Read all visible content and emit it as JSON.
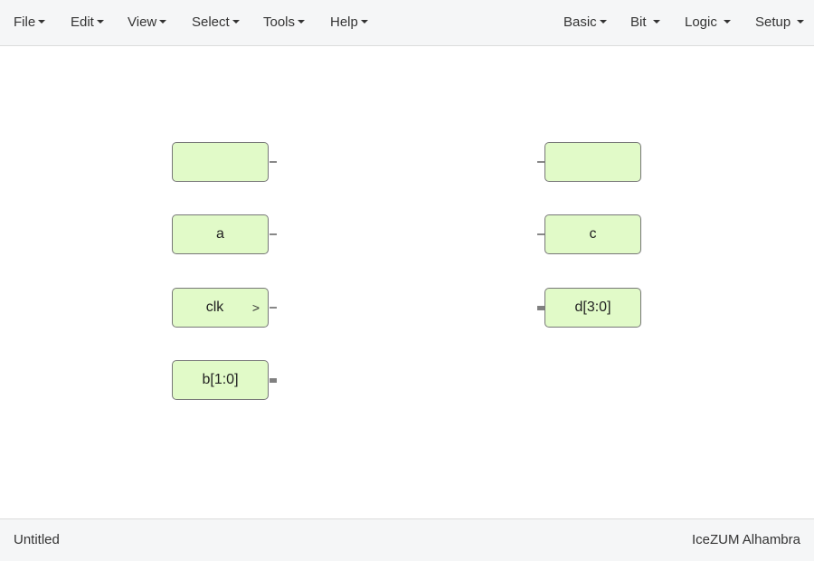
{
  "menubar": {
    "left": [
      {
        "label": "File"
      },
      {
        "label": "Edit"
      },
      {
        "label": "View"
      },
      {
        "label": "Select"
      },
      {
        "label": "Tools"
      },
      {
        "label": "Help"
      }
    ],
    "right": [
      {
        "label": "Basic"
      },
      {
        "label": "Bit"
      },
      {
        "label": "Logic"
      },
      {
        "label": "Setup"
      }
    ]
  },
  "blocks": {
    "input_1": {
      "label": ""
    },
    "input_a": {
      "label": "a"
    },
    "input_clk": {
      "label": "clk",
      "clock_symbol": ">"
    },
    "input_b": {
      "label": "b[1:0]"
    },
    "output_1": {
      "label": ""
    },
    "output_c": {
      "label": "c"
    },
    "output_d": {
      "label": "d[3:0]"
    }
  },
  "statusbar": {
    "project_name": "Untitled",
    "board": "IceZUM Alhambra"
  }
}
